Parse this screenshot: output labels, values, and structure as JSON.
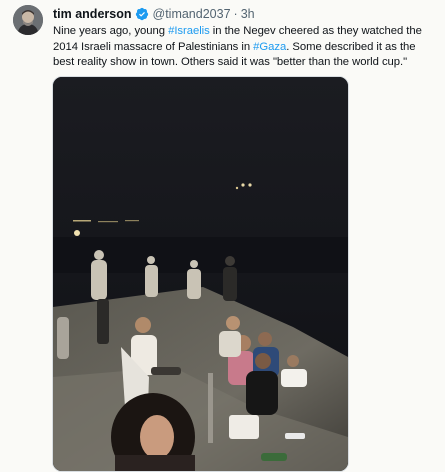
{
  "author": {
    "name": "tim anderson",
    "handle": "@timand2037",
    "separator": "·",
    "time": "3h",
    "verified_icon": "verified-badge-icon",
    "verified_color": "#1d9bf0"
  },
  "tweet": {
    "text_parts": [
      {
        "text": "Nine years ago, young "
      },
      {
        "text": "#Israelis",
        "hashtag": true
      },
      {
        "text": " in the Negev cheered as they watched the 2014 Israeli massacre of Palestinians in "
      },
      {
        "text": "#Gaza",
        "hashtag": true
      },
      {
        "text": ". Some described it as the best reality show in town. Others said it was \"better than the world cup.\""
      }
    ],
    "hashtag_color": "#1d9bf0",
    "media_description_icon": "night-crowd-photo"
  }
}
